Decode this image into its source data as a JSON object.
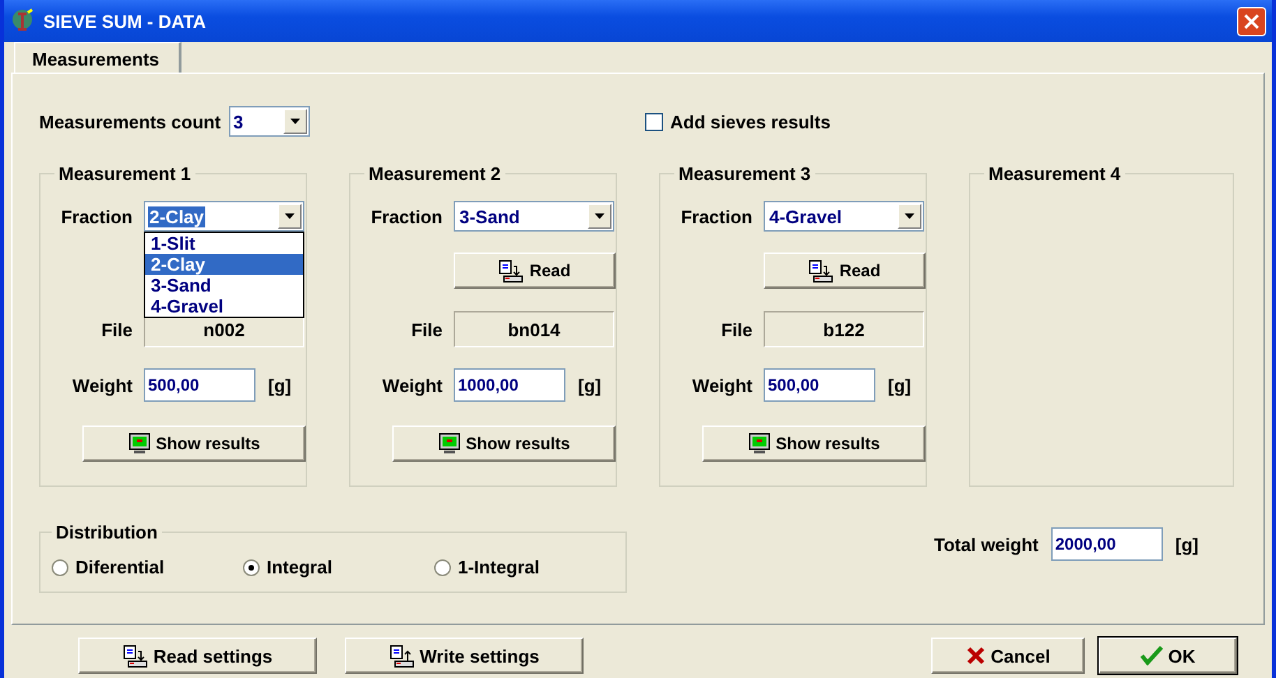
{
  "window": {
    "title": "SIEVE SUM - DATA"
  },
  "tabs": [
    {
      "label": "Measurements",
      "selected": true
    }
  ],
  "measurements_count": {
    "label": "Measurements count",
    "value": "3"
  },
  "add_sieves_results": {
    "label": "Add sieves results",
    "checked": false
  },
  "measurements": [
    {
      "title": "Measurement 1",
      "enabled": true,
      "fraction_label": "Fraction",
      "fraction": "2-Clay",
      "expanded": true,
      "options": [
        {
          "label": "1-Slit",
          "selected": false
        },
        {
          "label": "2-Clay",
          "selected": true
        },
        {
          "label": "3-Sand",
          "selected": false
        },
        {
          "label": "4-Gravel",
          "selected": false
        }
      ],
      "file_label": "File",
      "file": "n002",
      "weight_label": "Weight",
      "weight": "500,00",
      "unit": "[g]",
      "show_results": "Show results"
    },
    {
      "title": "Measurement 2",
      "enabled": true,
      "fraction_label": "Fraction",
      "fraction": "3-Sand",
      "expanded": false,
      "read": "Read",
      "file_label": "File",
      "file": "bn014",
      "weight_label": "Weight",
      "weight": "1000,00",
      "unit": "[g]",
      "show_results": "Show results"
    },
    {
      "title": "Measurement 3",
      "enabled": true,
      "fraction_label": "Fraction",
      "fraction": "4-Gravel",
      "expanded": false,
      "read": "Read",
      "file_label": "File",
      "file": "b122",
      "weight_label": "Weight",
      "weight": "500,00",
      "unit": "[g]",
      "show_results": "Show results"
    },
    {
      "title": "Measurement 4",
      "enabled": false
    }
  ],
  "distribution": {
    "title": "Distribution",
    "options": [
      {
        "label": "Diferential",
        "selected": false
      },
      {
        "label": "Integral",
        "selected": true
      },
      {
        "label": "1-Integral",
        "selected": false
      }
    ]
  },
  "total_weight": {
    "label": "Total weight",
    "value": "2000,00",
    "unit": "[g]"
  },
  "footer_buttons": [
    {
      "label": "Read settings",
      "kind": "read"
    },
    {
      "label": "Write settings",
      "kind": "write"
    },
    {
      "label": "Cancel",
      "kind": "cancel"
    },
    {
      "label": "OK",
      "kind": "ok"
    }
  ]
}
